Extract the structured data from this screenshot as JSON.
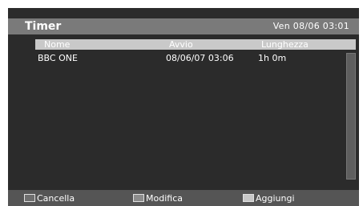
{
  "header": {
    "title": "Timer",
    "datetime": "Ven 08/06 03:01"
  },
  "table": {
    "columns": [
      "Nome",
      "Avvio",
      "Lunghezza"
    ],
    "rows": [
      {
        "name": "BBC ONE",
        "start": "08/06/07  03:06",
        "length": "1h 0m"
      }
    ]
  },
  "footer": {
    "buttons": [
      {
        "label": "Cancella",
        "color": "#6e6e6e"
      },
      {
        "label": "Modifica",
        "color": "#8c8c8c"
      },
      {
        "label": "Aggiungi",
        "color": "#c8c8c8"
      }
    ]
  }
}
